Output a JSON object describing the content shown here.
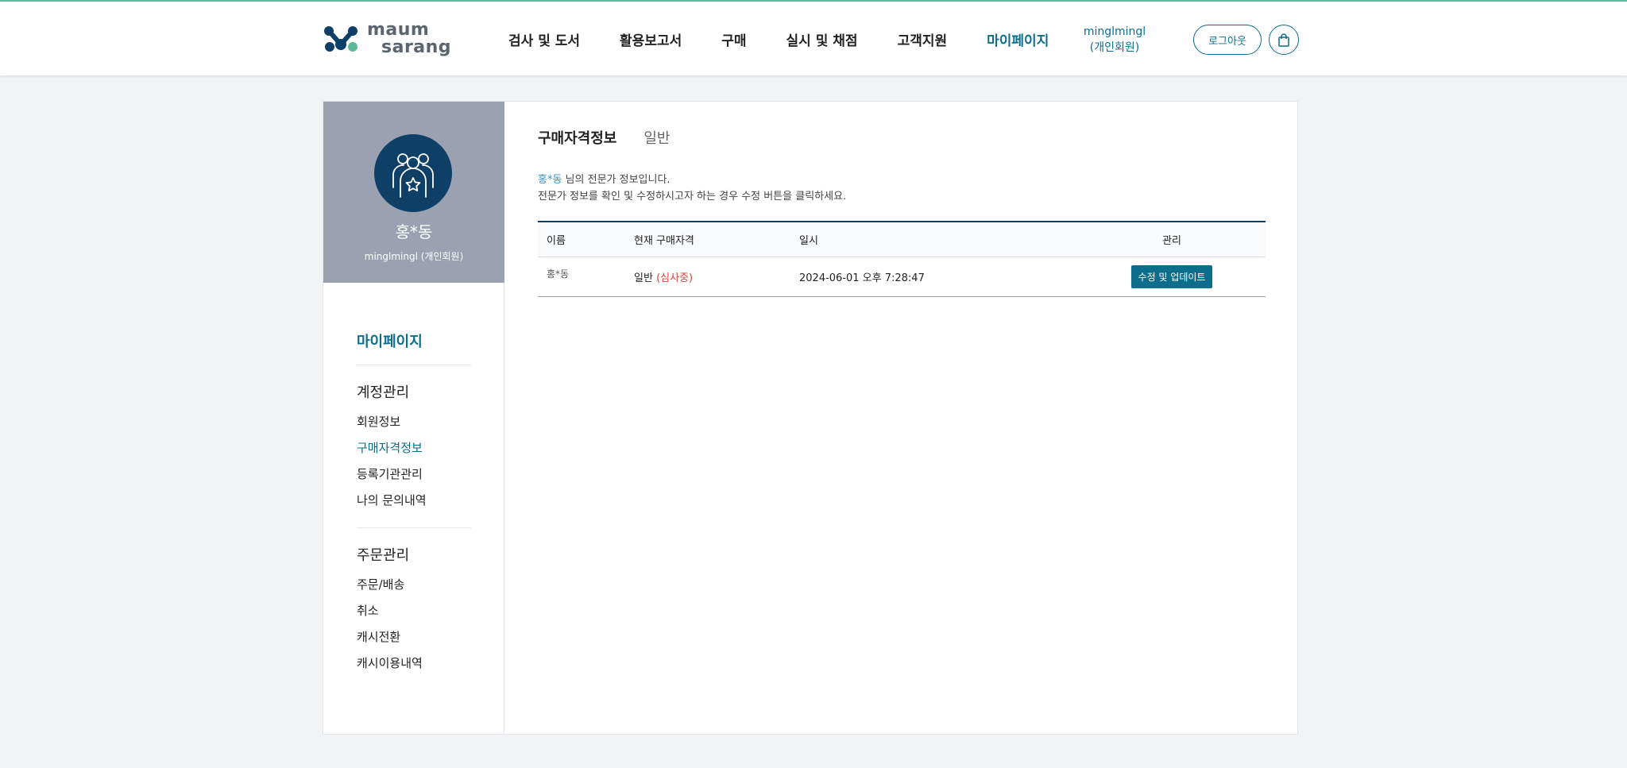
{
  "header": {
    "logo": {
      "line1": "maum",
      "line2": "sarang"
    },
    "nav": [
      {
        "label": "검사 및 도서"
      },
      {
        "label": "활용보고서"
      },
      {
        "label": "구매"
      },
      {
        "label": "실시 및 채점"
      },
      {
        "label": "고객지원"
      },
      {
        "label": "마이페이지"
      }
    ],
    "user": {
      "id": "minglmingl",
      "type": "(개인회원)"
    },
    "logout_label": "로그아웃",
    "accent_color": "#0c6e8a"
  },
  "sidebar": {
    "profile": {
      "name": "홍*동",
      "id_line": "minglmingl (개인회원)"
    },
    "menu_title": "마이페이지",
    "groups": [
      {
        "title": "계정관리",
        "items": [
          "회원정보",
          "구매자격정보",
          "등록기관관리",
          "나의 문의내역"
        ]
      },
      {
        "title": "주문관리",
        "items": [
          "주문/배송",
          "취소",
          "캐시전환",
          "캐시이용내역"
        ]
      }
    ]
  },
  "main": {
    "tabs": [
      "구매자격정보",
      "일반"
    ],
    "desc": {
      "name": "홍*동",
      "line1_suffix": " 님의 전문가 정보입니다.",
      "line2": "전문가 정보를 확인 및 수정하시고자 하는 경우 수정 버튼을 클릭하세요."
    },
    "table": {
      "headers": [
        "이름",
        "현재 구매자격",
        "일시",
        "관리"
      ],
      "rows": [
        {
          "name": "홍*동",
          "qualification": "일반",
          "status": "(심사중)",
          "datetime": "2024-06-01 오후 7:28:47",
          "action": "수정 및 업데이트"
        }
      ]
    }
  }
}
